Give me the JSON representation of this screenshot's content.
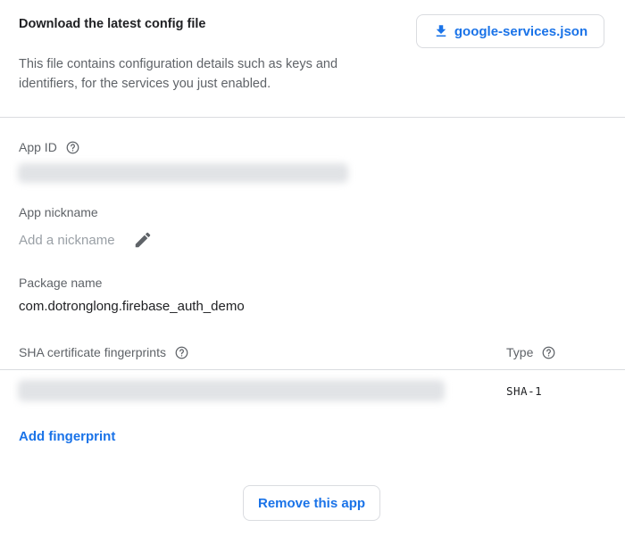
{
  "config": {
    "title": "Download the latest config file",
    "description": "This file contains configuration details such as keys and identifiers, for the services you just enabled.",
    "download_button_label": "google-services.json"
  },
  "app_id": {
    "label": "App ID"
  },
  "nickname": {
    "label": "App nickname",
    "placeholder": "Add a nickname"
  },
  "package": {
    "label": "Package name",
    "value": "com.dotronglong.firebase_auth_demo"
  },
  "fingerprints": {
    "header_label": "SHA certificate fingerprints",
    "type_header": "Type",
    "rows": [
      {
        "type": "SHA-1"
      }
    ],
    "add_label": "Add fingerprint"
  },
  "remove_button_label": "Remove this app",
  "colors": {
    "accent": "#1a73e8",
    "text": "#202124",
    "secondary": "#5f6368",
    "divider": "#dadce0"
  }
}
